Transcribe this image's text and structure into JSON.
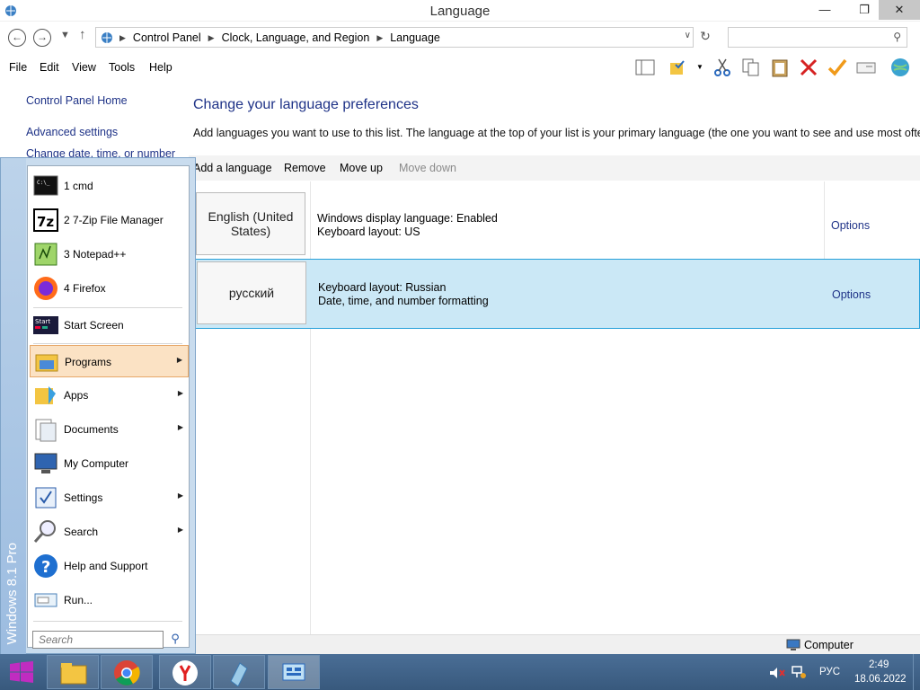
{
  "window": {
    "title": "Language",
    "minimize": "—",
    "maximize": "❐",
    "close": "✕"
  },
  "address": {
    "crumbs": [
      "Control Panel",
      "Clock, Language, and Region",
      "Language"
    ],
    "search_placeholder": ""
  },
  "menu": [
    "File",
    "Edit",
    "View",
    "Tools",
    "Help"
  ],
  "leftnav": {
    "home": "Control Panel Home",
    "advanced": "Advanced settings",
    "change_date": "Change date, time, or number"
  },
  "main": {
    "title": "Change your language preferences",
    "description": "Add languages you want to use to this list. The language at the top of your list is your primary language (the one you want to see and use most often).",
    "commands": {
      "add": "Add a language",
      "remove": "Remove",
      "move_up": "Move up",
      "move_down": "Move down"
    },
    "languages": [
      {
        "name": "English (United States)",
        "line1": "Windows display language: Enabled",
        "line2": "Keyboard layout: US",
        "options": "Options"
      },
      {
        "name": "русский",
        "line1": "Keyboard layout: Russian",
        "line2": "Date, time, and number formatting",
        "options": "Options"
      }
    ]
  },
  "status": {
    "computer": "Computer"
  },
  "startmenu": {
    "edition": "Windows 8.1 Pro",
    "items": [
      {
        "label": "1 cmd"
      },
      {
        "label": "2 7-Zip File Manager"
      },
      {
        "label": "3 Notepad++"
      },
      {
        "label": "4 Firefox"
      },
      {
        "label": "Start Screen"
      },
      {
        "label": "Programs"
      },
      {
        "label": "Apps"
      },
      {
        "label": "Documents"
      },
      {
        "label": "My Computer"
      },
      {
        "label": "Settings"
      },
      {
        "label": "Search"
      },
      {
        "label": "Help and Support"
      },
      {
        "label": "Run..."
      }
    ],
    "search_placeholder": "Search",
    "icon_7zip": "7z",
    "icon_start": "Start",
    "icon_cmd": "C:\\_"
  },
  "taskbar": {
    "lang": "РУС",
    "time": "2:49",
    "date": "18.06.2022"
  },
  "colors": {
    "link": "#1e3287",
    "selected_row": "#cbe8f6",
    "taskbar": "#38597d"
  }
}
